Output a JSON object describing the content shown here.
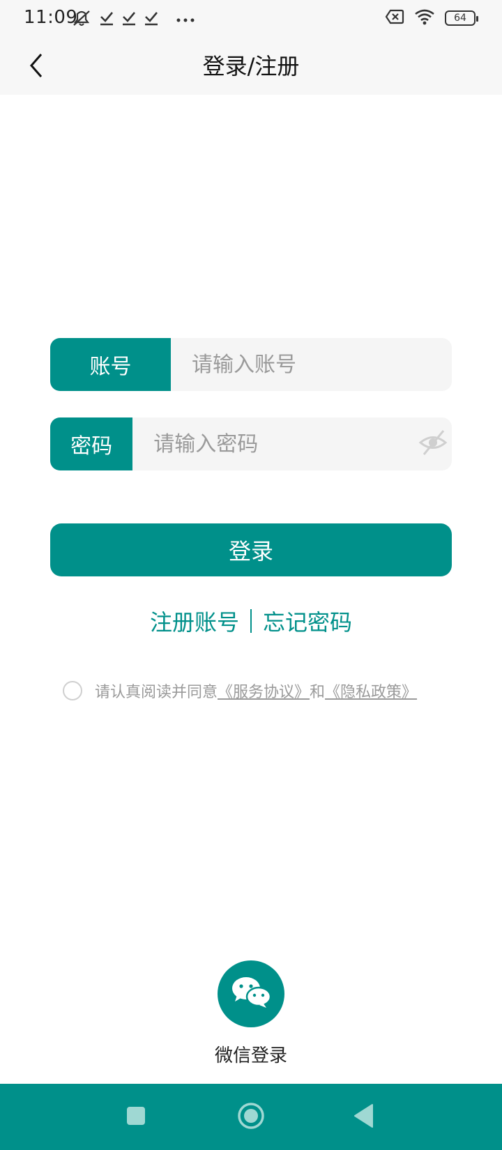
{
  "status_bar": {
    "time": "11:09",
    "battery": "64",
    "left_icons": [
      "mute-icon",
      "check-icon",
      "check-icon",
      "check-icon",
      "more-dots-icon"
    ],
    "right_icons": [
      "no-sim-icon",
      "wifi-icon",
      "battery-icon"
    ]
  },
  "header": {
    "title": "登录/注册",
    "back_icon": "chevron-left-icon"
  },
  "form": {
    "account_label": "账号",
    "account_placeholder": "请输入账号",
    "password_label": "密码",
    "password_placeholder": "请输入密码",
    "password_toggle_icon": "eye-off-icon"
  },
  "login_button_label": "登录",
  "links": {
    "register": "注册账号",
    "forgot": "忘记密码"
  },
  "agreement": {
    "prefix": "请认真阅读并同意",
    "service_link": "《服务协议》",
    "and": "和",
    "privacy_link": "《隐私政策》"
  },
  "wechat": {
    "label": "微信登录",
    "icon": "wechat-icon"
  },
  "nav_bar": {
    "icons": [
      "recent-apps-icon",
      "home-icon",
      "back-triangle-icon"
    ]
  },
  "colors": {
    "primary": "#00908a",
    "background": "#ffffff",
    "header_background": "#f7f7f7",
    "input_background": "#f5f5f5",
    "muted_text": "#9a9a9a"
  }
}
